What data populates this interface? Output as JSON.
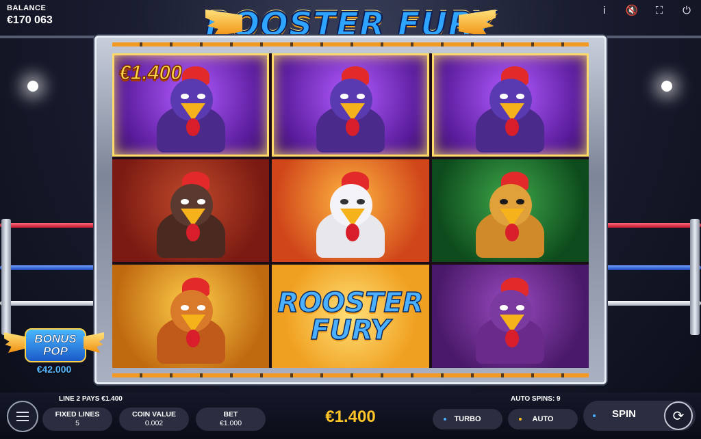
{
  "balance": {
    "label": "BALANCE",
    "value": "€170 063"
  },
  "top_icons": [
    "info-icon",
    "mute-icon",
    "fullscreen-icon",
    "power-icon"
  ],
  "top_glyphs": {
    "info": "i",
    "mute": "🔇",
    "fullscreen": "⛶",
    "power": "⏻"
  },
  "logo": {
    "text": "ROOSTER FURY"
  },
  "reels": {
    "win_amount": "€1.400",
    "symbol_logo_line1": "ROOSTER",
    "symbol_logo_line2": "FURY",
    "cells": [
      {
        "symbol": "purple-masked-rooster",
        "winning": true
      },
      {
        "symbol": "purple-masked-rooster",
        "winning": true
      },
      {
        "symbol": "purple-masked-rooster",
        "winning": true
      },
      {
        "symbol": "red-boxer-rooster",
        "winning": false
      },
      {
        "symbol": "white-fighter-rooster",
        "winning": false
      },
      {
        "symbol": "green-masked-rooster",
        "winning": false
      },
      {
        "symbol": "yellow-rooster",
        "winning": false
      },
      {
        "symbol": "rooster-fury-logo",
        "winning": false
      },
      {
        "symbol": "violet-hooded-rooster",
        "winning": false
      }
    ]
  },
  "bonus_pop": {
    "line1": "BONUS",
    "line2": "POP",
    "amount": "€42.000"
  },
  "bottom": {
    "line_message": "LINE 2 PAYS €1.400",
    "auto_spins_message": "AUTO SPINS: 9",
    "fixed_lines": {
      "label": "FIXED LINES",
      "value": "5"
    },
    "coin_value": {
      "label": "COIN VALUE",
      "value": "0.002"
    },
    "bet": {
      "label": "BET",
      "value": "€1.000"
    },
    "total_win": "€1.400",
    "turbo_label": "TURBO",
    "auto_label": "AUTO",
    "spin_label": "SPIN",
    "spin_glyph": "⟳"
  },
  "colors": {
    "accent_gold": "#ffc428",
    "accent_blue": "#4ab0ff"
  }
}
